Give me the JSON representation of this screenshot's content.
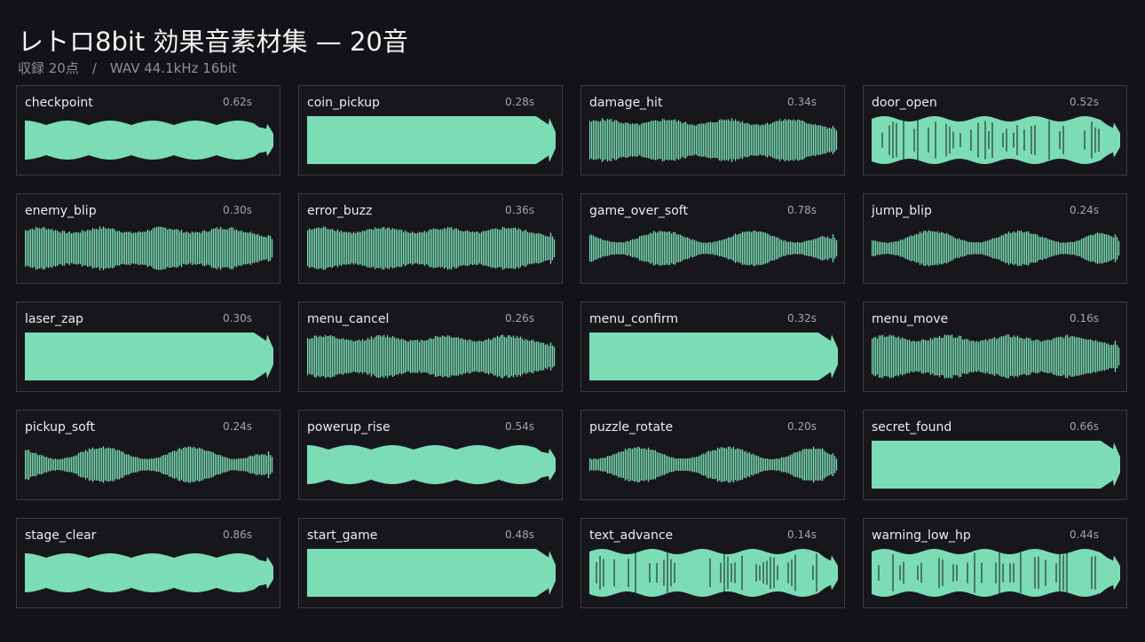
{
  "header": {
    "title": "レトロ8bit 効果音素材集 — 20音",
    "subtitle": "収録 20点　/　WAV 44.1kHz 16bit"
  },
  "colors": {
    "background": "#131317",
    "card_border": "#3a3a40",
    "waveform": "#7bdcb5"
  },
  "clips": [
    {
      "name": "checkpoint",
      "duration": "0.62s",
      "waveform_style": "pulse-lobes"
    },
    {
      "name": "coin_pickup",
      "duration": "0.28s",
      "waveform_style": "solid"
    },
    {
      "name": "damage_hit",
      "duration": "0.34s",
      "waveform_style": "dense-lines"
    },
    {
      "name": "door_open",
      "duration": "0.52s",
      "waveform_style": "noisy-solid"
    },
    {
      "name": "enemy_blip",
      "duration": "0.30s",
      "waveform_style": "dense-lines"
    },
    {
      "name": "error_buzz",
      "duration": "0.36s",
      "waveform_style": "dense-lines"
    },
    {
      "name": "game_over_soft",
      "duration": "0.78s",
      "waveform_style": "wavy-lines"
    },
    {
      "name": "jump_blip",
      "duration": "0.24s",
      "waveform_style": "wavy-lines"
    },
    {
      "name": "laser_zap",
      "duration": "0.30s",
      "waveform_style": "solid"
    },
    {
      "name": "menu_cancel",
      "duration": "0.26s",
      "waveform_style": "dense-lines"
    },
    {
      "name": "menu_confirm",
      "duration": "0.32s",
      "waveform_style": "solid"
    },
    {
      "name": "menu_move",
      "duration": "0.16s",
      "waveform_style": "dense-lines"
    },
    {
      "name": "pickup_soft",
      "duration": "0.24s",
      "waveform_style": "wavy-lines"
    },
    {
      "name": "powerup_rise",
      "duration": "0.54s",
      "waveform_style": "pulse-lobes"
    },
    {
      "name": "puzzle_rotate",
      "duration": "0.20s",
      "waveform_style": "wavy-lines"
    },
    {
      "name": "secret_found",
      "duration": "0.66s",
      "waveform_style": "solid"
    },
    {
      "name": "stage_clear",
      "duration": "0.86s",
      "waveform_style": "pulse-lobes"
    },
    {
      "name": "start_game",
      "duration": "0.48s",
      "waveform_style": "solid"
    },
    {
      "name": "text_advance",
      "duration": "0.14s",
      "waveform_style": "noisy-solid"
    },
    {
      "name": "warning_low_hp",
      "duration": "0.44s",
      "waveform_style": "noisy-solid"
    }
  ]
}
